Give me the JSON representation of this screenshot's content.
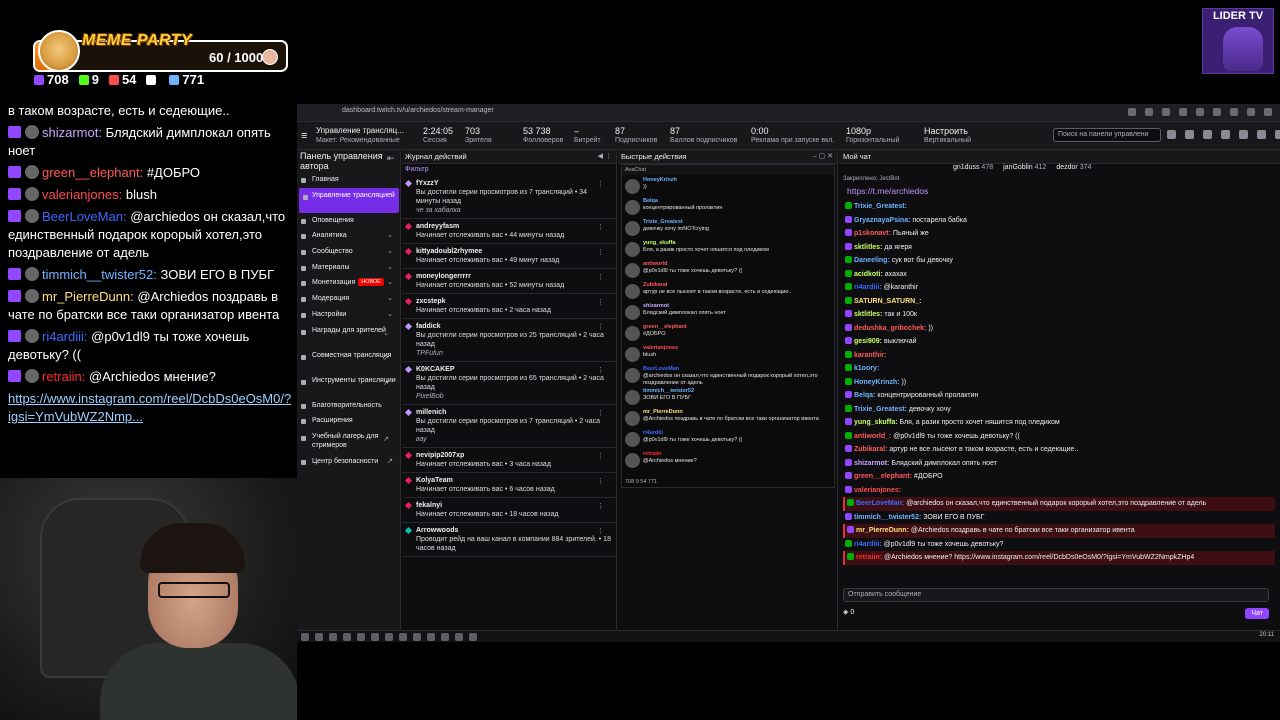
{
  "overlay": {
    "meme_title": "MEME PARTY",
    "meme_count": "60 / 1000",
    "meme_progress": 0.06,
    "stats": [
      {
        "icon": "twitch-icon",
        "value": "708",
        "color": "#9146ff"
      },
      {
        "icon": "kick-icon",
        "value": "9",
        "color": "#53fc18"
      },
      {
        "icon": "vk-icon",
        "value": "54",
        "color": "#ff4b4b"
      },
      {
        "icon": "w-icon",
        "value": "",
        "color": "#ffffff"
      },
      {
        "icon": "viewers-icon",
        "value": "771",
        "color": "#6fb3ff"
      }
    ],
    "chat": [
      {
        "name": "",
        "color": "#ffffff",
        "text": "в таком возрасте, есть и седеющие.."
      },
      {
        "name": "shizarmot:",
        "color": "#c9a7ff",
        "text": "Блядский димплокал опять ноет"
      },
      {
        "name": "green__elephant:",
        "color": "#ff5a5a",
        "text": "#ДОБРО"
      },
      {
        "name": "valerianjones:",
        "color": "#ff4d4d",
        "text": "blush"
      },
      {
        "name": "BeerLoveMan:",
        "color": "#3a6bff",
        "text": "@archiedos он сказал,что единственный подарок корорый хотел,это поздравление от адель"
      },
      {
        "name": "timmich__twister52:",
        "color": "#6fb3ff",
        "text": "ЗОВИ ЕГО В ПУБГ"
      },
      {
        "name": "mr_PierreDunn:",
        "color": "#ffe083",
        "text": "@Archiedos поздравь в чате по братски все таки организатор ивента"
      },
      {
        "name": "ri4ardiii:",
        "color": "#3a6bff",
        "text": "@p0v1dl9 ты тоже хочешь девотьку? (("
      },
      {
        "name": "retraiin:",
        "color": "#ff2a2a",
        "text": "@Archiedos мнение?"
      }
    ],
    "link": "https://www.instagram.com/reel/DcbDs0eOsM0/?igsi=YmVubWZ2Nmp..."
  },
  "brand": {
    "title": "LIDER TV"
  },
  "browser": {
    "url": "dashboard.twitch.tv/u/archiedos/stream-manager"
  },
  "top_strip": {
    "menu_icon": "≡",
    "title": "Управление трансляц...",
    "subtitle": "Макет: Рекомендованные",
    "stats": [
      {
        "value": "2:24:05",
        "label": "Сессия"
      },
      {
        "value": "703",
        "label": "Зрителя"
      },
      {
        "value": "53 738",
        "label": "Фолловеров"
      },
      {
        "value": "–",
        "label": "Битрейт"
      },
      {
        "value": "87",
        "label": "Подписчиков"
      },
      {
        "value": "87",
        "label": "Баллов подписчиков"
      },
      {
        "value": "0:00",
        "label": "Реклама при запуске вкл."
      },
      {
        "value": "1080p",
        "label": "Горизонтальный"
      },
      {
        "value": "Настроить",
        "label": "Вертикальный"
      }
    ],
    "search_placeholder": "Поиск на панели управлени"
  },
  "nav": {
    "title": "Панель управления автора",
    "items": [
      {
        "label": "Главная"
      },
      {
        "label": "Управление трансляцией"
      },
      {
        "label": "Оповещения"
      },
      {
        "label": "Аналитика"
      },
      {
        "label": "Сообщество"
      },
      {
        "label": "Материалы"
      },
      {
        "label": "Монетизация"
      },
      {
        "label": "Модерация"
      },
      {
        "label": "Настройки"
      },
      {
        "label": "Награды для зрителей"
      },
      {
        "label": "Совместная трансляция"
      },
      {
        "label": "Инструменты трансляции"
      },
      {
        "label": "Благотворительность"
      },
      {
        "label": "Расширения"
      },
      {
        "label": "Учебный лагерь для стримеров"
      },
      {
        "label": "Центр безопасности"
      }
    ],
    "new_badge": "НОВОЕ"
  },
  "feed": {
    "title": "Журнал действий",
    "filter": "Фильтр",
    "items": [
      {
        "user": "fYxzzY",
        "text": "Вы достигли серии просмотров из 7 трансляций • 34 минуты назад",
        "note": "че за хабалка",
        "kind": "star"
      },
      {
        "user": "andreyyfasm",
        "text": "Начинает отслеживать вас • 44 минуты назад",
        "note": "",
        "kind": "follow"
      },
      {
        "user": "kittyadoubl2rhymee",
        "text": "Начинает отслеживать вас • 49 минут назад",
        "note": "",
        "kind": "follow"
      },
      {
        "user": "moneylongerrrrr",
        "text": "Начинает отслеживать вас • 52 минуты назад",
        "note": "",
        "kind": "follow"
      },
      {
        "user": "zxcstepk",
        "text": "Начинает отслеживать вас • 2 часа назад",
        "note": "",
        "kind": "follow"
      },
      {
        "user": "faddick",
        "text": "Вы достигли серии просмотров из 25 трансляций • 2 часа назад",
        "note": "TPFufun",
        "kind": "star"
      },
      {
        "user": "K0KCAKEP",
        "text": "Вы достигли серии просмотров из 65 трансляций • 2 часа назад",
        "note": "PixelBob",
        "kind": "star"
      },
      {
        "user": "millenich",
        "text": "Вы достигли серии просмотров из 7 трансляций • 2 часа назад",
        "note": "вау",
        "kind": "star"
      },
      {
        "user": "nevipip2007xp",
        "text": "Начинает отслеживать вас • 3 часа назад",
        "note": "",
        "kind": "follow"
      },
      {
        "user": "KolyaTeam",
        "text": "Начинает отслеживать вас • 6 часов назад",
        "note": "",
        "kind": "follow"
      },
      {
        "user": "fekalnyi",
        "text": "Начинает отслеживать вас • 18 часов назад",
        "note": "",
        "kind": "follow"
      },
      {
        "user": "Arrowwoods",
        "text": "Проводит рейд на ваш канал в компании 884 зрителей. • 18 часов назад",
        "note": "",
        "kind": "raid"
      }
    ]
  },
  "quick": {
    "title": "Быстрые действия",
    "mini_head": "AvaChat",
    "messages": [
      {
        "name": "HoneyKrinzh",
        "color": "#6fb3ff",
        "text": "))"
      },
      {
        "name": "Belqa",
        "color": "#6fb3ff",
        "text": "концентрированный пролактин"
      },
      {
        "name": "Trixie_Greatest",
        "color": "#6fb3ff",
        "text": "девочку хочу imNOTcrying"
      },
      {
        "name": "yung_skuffa",
        "color": "#c8ff6a",
        "text": "Бля, а разик просто хочет няшится под пледиком"
      },
      {
        "name": "antiworld_",
        "color": "#ff5a5a",
        "text": "@p0v1dl9 ты тоже хочешь девотьку? (("
      },
      {
        "name": "Zubikaral",
        "color": "#ff5a5a",
        "text": "артур не все лысеют в таком возрасте, есть и седеющие.."
      },
      {
        "name": "shizarmot",
        "color": "#c9a7ff",
        "text": "Блядский димплокал опять ноет"
      },
      {
        "name": "green__elephant",
        "color": "#ff5a5a",
        "text": "#ДОБРО"
      },
      {
        "name": "valerianjones",
        "color": "#ff4d4d",
        "text": "blush"
      },
      {
        "name": "BeerLoveMan",
        "color": "#3a6bff",
        "text": "@archiedos он сказал,что единственный подарок корорый хотел,это поздравление от адель"
      },
      {
        "name": "timmich__twister52",
        "color": "#6fb3ff",
        "text": "ЗОВИ ЕГО В ПУБГ"
      },
      {
        "name": "mr_PierreDunn",
        "color": "#ffe083",
        "text": "@Archiedos поздравь в чате по братски все таки организатор ивента"
      },
      {
        "name": "ri4ardiii",
        "color": "#3a6bff",
        "text": "@p0v1dl9 ты тоже хочешь девотьку? (("
      },
      {
        "name": "retraiin",
        "color": "#ff2a2a",
        "text": "@Archiedos мнение?"
      }
    ],
    "foot": "708  9  54    771"
  },
  "mychat": {
    "title": "Мой чат",
    "leaders": [
      {
        "name": "gn1duss",
        "value": "478"
      },
      {
        "name": "janGoblin",
        "value": "412"
      },
      {
        "name": "dezdor",
        "value": "374"
      }
    ],
    "pinned_label": "Закреплено: JestBot",
    "pinned_link": "https://t.me/archiedos",
    "messages": [
      {
        "name": "Trixie_Greatest:",
        "color": "#6fb3ff",
        "text": "",
        "badge": "green",
        "hl": false
      },
      {
        "name": "GryaznayaPsina:",
        "color": "#6fb3ff",
        "text": "постарела бабка",
        "badge": "",
        "hl": false
      },
      {
        "name": "p1skonavt:",
        "color": "#ff5a5a",
        "text": "Пьяный же",
        "badge": "",
        "hl": false
      },
      {
        "name": "sktlitles:",
        "color": "#c8ff6a",
        "text": "да ягеря",
        "badge": "",
        "hl": false
      },
      {
        "name": "Daneeling:",
        "color": "#6fb3ff",
        "text": "сук вот бы девочку",
        "badge": "green",
        "hl": false
      },
      {
        "name": "acidkoti:",
        "color": "#c8ff6a",
        "text": "ахахах",
        "badge": "green",
        "hl": false
      },
      {
        "name": "ri4ardiii:",
        "color": "#3a6bff",
        "text": "@karanthir",
        "badge": "green",
        "hl": false
      },
      {
        "name": "SATURN_SATURN_:",
        "color": "#ffe083",
        "text": "",
        "badge": "green",
        "hl": false
      },
      {
        "name": "sktlitles:",
        "color": "#c8ff6a",
        "text": "так и 100к",
        "badge": "",
        "hl": false
      },
      {
        "name": "dedushka_gribochek:",
        "color": "#ff5a5a",
        "text": "))",
        "badge": "",
        "hl": false
      },
      {
        "name": "gesi909:",
        "color": "#c8ff6a",
        "text": "выключай",
        "badge": "",
        "hl": false
      },
      {
        "name": "karanthir:",
        "color": "#ff5a5a",
        "text": "",
        "badge": "green",
        "hl": false
      },
      {
        "name": "k1oory:",
        "color": "#6fb3ff",
        "text": "",
        "badge": "green",
        "hl": false
      },
      {
        "name": "HoneyKrinzh:",
        "color": "#6fb3ff",
        "text": "))",
        "badge": "green",
        "hl": false
      },
      {
        "name": "Belqa:",
        "color": "#6fb3ff",
        "text": "концентрированный пролактин",
        "badge": "",
        "hl": false
      },
      {
        "name": "Trixie_Greatest:",
        "color": "#6fb3ff",
        "text": "девочку хочу",
        "badge": "green",
        "hl": false
      },
      {
        "name": "yung_skuffa:",
        "color": "#c8ff6a",
        "text": "Бля, а разик просто хочет няшится под пледиком",
        "badge": "",
        "hl": false
      },
      {
        "name": "antiworld_:",
        "color": "#ff5a5a",
        "text": "@p0v1dl9 ты тоже хочешь девотьку? ((",
        "badge": "green",
        "hl": false
      },
      {
        "name": "Zubikaral:",
        "color": "#ff5a5a",
        "text": "артур не все лысеют в таком возрасте, есть и седеющие..",
        "badge": "",
        "hl": false
      },
      {
        "name": "shizarmot:",
        "color": "#c9a7ff",
        "text": "Блядский димплокал опять ноет",
        "badge": "",
        "hl": false
      },
      {
        "name": "green__elephant:",
        "color": "#ff5a5a",
        "text": "#ДОБРО",
        "badge": "",
        "hl": false
      },
      {
        "name": "valerianjones:",
        "color": "#ff4d4d",
        "text": "",
        "badge": "",
        "hl": false
      },
      {
        "name": "BeerLoveMan:",
        "color": "#3a6bff",
        "text": "@archiedos он сказал,что единственный подарок корорый хотел,это поздравление от адель",
        "badge": "green",
        "hl": true
      },
      {
        "name": "timmich__twister52:",
        "color": "#6fb3ff",
        "text": "ЗОВИ ЕГО В ПУБГ",
        "badge": "",
        "hl": false
      },
      {
        "name": "mr_PierreDunn:",
        "color": "#ffe083",
        "text": "@Archiedos поздравь в чате по братски все таки организатор ивента",
        "badge": "",
        "hl": true
      },
      {
        "name": "ri4ardiii:",
        "color": "#3a6bff",
        "text": "@p0v1dl9 ты тоже хочешь девотьку?",
        "badge": "green",
        "hl": false
      },
      {
        "name": "retraiin:",
        "color": "#ff2a2a",
        "text": "@Archiedos мнение? https://www.instagram.com/reel/DcbDs0eOsM0/?igsi=YmVubWZ2NmpkZHp4",
        "badge": "green",
        "hl": true
      }
    ],
    "input_placeholder": "Отправить сообщение",
    "points": "0",
    "send": "Чат"
  },
  "taskbar": {
    "time": "20:11"
  }
}
